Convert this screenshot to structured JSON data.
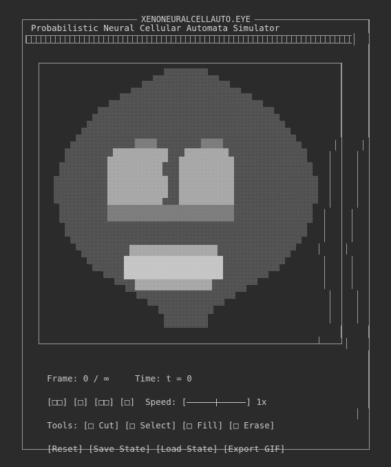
{
  "window": {
    "title": "XENONEURALCELLAUTO.EYE",
    "subtitle": "Probabilistic Neural Cellular Automata Simulator"
  },
  "status": {
    "frame_label": "Frame:",
    "frame_value": "0 / ∞",
    "time_label": "Time:",
    "time_value": "t = 0"
  },
  "transport": {
    "buttons": [
      "[□□]",
      "[□]",
      "[□□]",
      "[□]"
    ],
    "speed_label": "Speed:",
    "speed_left": "[",
    "speed_right": "]",
    "speed_value": "1x",
    "speed_fraction": 0.5
  },
  "tools": {
    "label": "Tools:",
    "items": [
      "[□ Cut]",
      "[□ Select]",
      "[□ Fill]",
      "[□ Erase]"
    ]
  },
  "actions": [
    "[Reset]",
    "[Save State]",
    "[Load State]",
    "[Export GIF]"
  ],
  "colors": {
    "background": "#2b2b2b",
    "border": "#9a9a9a",
    "face_dark": "#707070",
    "face_mid": "#9a9a9a",
    "face_light": "#bdbdbd",
    "face_brightest": "#d8d8d8"
  }
}
